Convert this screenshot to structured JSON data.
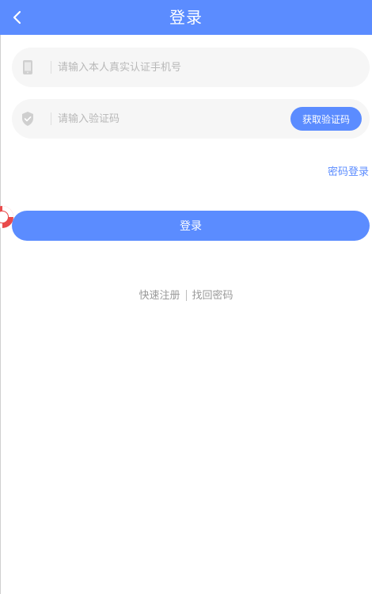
{
  "header": {
    "title": "登录",
    "back_icon": "chevron-left-icon"
  },
  "form": {
    "phone": {
      "placeholder": "请输入本人真实认证手机号",
      "value": "",
      "icon": "phone-icon"
    },
    "code": {
      "placeholder": "请输入验证码",
      "value": "",
      "icon": "shield-check-icon",
      "get_code_label": "获取验证码"
    }
  },
  "password_login_label": "密码登录",
  "login_label": "登录",
  "footer": {
    "register_label": "快速注册",
    "recover_label": "找回密码"
  },
  "floating": {
    "icon": "lifebuoy-icon"
  },
  "colors": {
    "primary": "#5b8cff",
    "field_bg": "#f6f6f6",
    "placeholder": "#b8b8b8",
    "muted_text": "#999999"
  }
}
